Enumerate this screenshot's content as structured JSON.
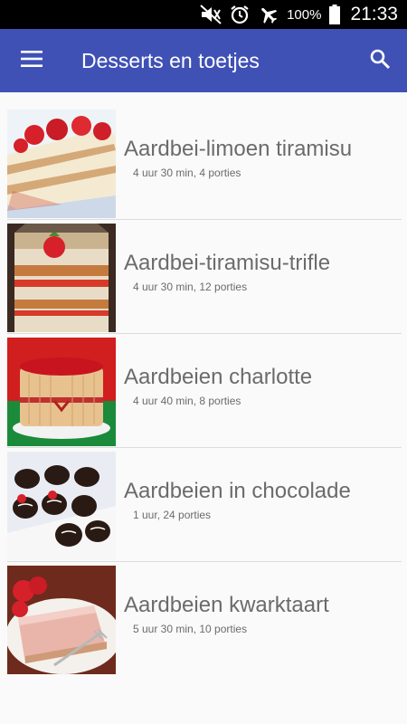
{
  "status_bar": {
    "icons": [
      "mute-icon",
      "alarm-icon",
      "airplane-mode-icon",
      "battery-icon"
    ],
    "battery": "100%",
    "time": "21:33"
  },
  "app_bar": {
    "menu_icon": "hamburger-menu-icon",
    "title": "Desserts en toetjes",
    "search_icon": "search-icon"
  },
  "recipes": [
    {
      "name": "Aardbei-limoen tiramisu",
      "meta": "4 uur 30 min, 4 porties"
    },
    {
      "name": "Aardbei-tiramisu-trifle",
      "meta": "4 uur 30 min, 12 porties"
    },
    {
      "name": "Aardbeien charlotte",
      "meta": "4 uur 40 min, 8 porties"
    },
    {
      "name": "Aardbeien in chocolade",
      "meta": "1 uur, 24 porties"
    },
    {
      "name": "Aardbeien kwarktaart",
      "meta": "5 uur 30 min, 10 porties"
    }
  ],
  "colors": {
    "app_bar": "#3f51b5",
    "status_bar": "#000000",
    "background": "#fafafa",
    "text": "#6b6b6b"
  }
}
